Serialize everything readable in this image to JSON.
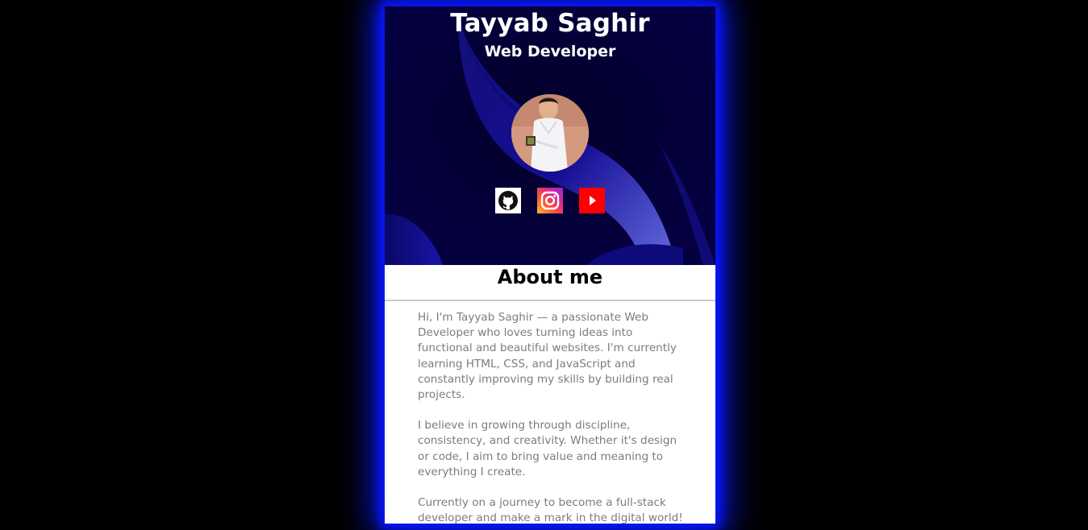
{
  "profile": {
    "name": "Tayyab Saghir",
    "role": "Web Developer"
  },
  "socials": [
    {
      "name": "GitHub",
      "icon": "github-icon"
    },
    {
      "name": "Instagram",
      "icon": "instagram-icon"
    },
    {
      "name": "YouTube",
      "icon": "youtube-icon"
    }
  ],
  "about": {
    "title": "About me",
    "paragraphs": [
      "Hi, I'm Tayyab Saghir — a passionate Web Developer who loves turning ideas into functional and beautiful websites. I'm currently learning HTML, CSS, and JavaScript and constantly improving my skills by building real projects.",
      "I believe in growing through discipline, consistency, and creativity. Whether it's design or code, I aim to bring value and meaning to everything I create.",
      "Currently on a journey to become a full-stack developer and make a mark in the digital world!"
    ]
  },
  "colors": {
    "page_background": "#000000",
    "glow": "#0a18ff",
    "hero_background": "#020030",
    "body_text": "#7c7c7c"
  }
}
